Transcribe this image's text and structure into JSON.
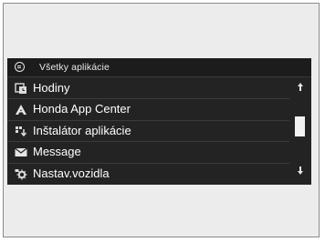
{
  "header": {
    "title": "Všetky aplikácie",
    "icon": "apps-menu-icon"
  },
  "apps": [
    {
      "label": "Hodiny",
      "icon": "clock-icon"
    },
    {
      "label": "Honda App Center",
      "icon": "honda-app-center-icon"
    },
    {
      "label": "Inštalátor aplikácie",
      "icon": "app-installer-icon"
    },
    {
      "label": "Message",
      "icon": "envelope-icon"
    },
    {
      "label": "Nastav.vozidla",
      "icon": "vehicle-settings-icon"
    }
  ],
  "scrollbar": {
    "position_fraction": 0.38
  },
  "colors": {
    "panel_bg": "#232323",
    "text": "#ffffff",
    "frame_bg": "#ececec"
  }
}
